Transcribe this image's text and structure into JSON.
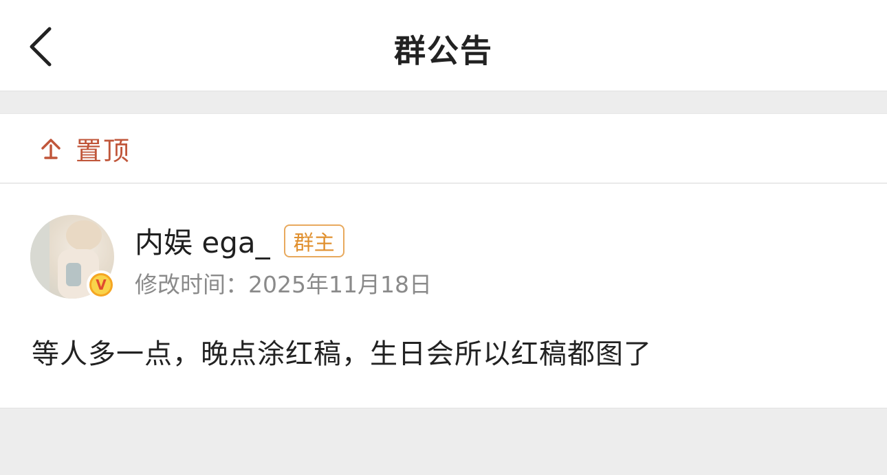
{
  "header": {
    "title": "群公告",
    "back_icon": "chevron-left-icon"
  },
  "pin": {
    "icon": "pin-top-icon",
    "label": "置顶",
    "color": "#c0563a"
  },
  "post": {
    "author": "内娱 ega_",
    "owner_badge": "群主",
    "modified_label": "修改时间：",
    "modified_date": "2025年11月18日",
    "content": "等人多一点，晚点涂红稿，生日会所以红稿都图了",
    "verified_icon": "verified-v-icon"
  }
}
